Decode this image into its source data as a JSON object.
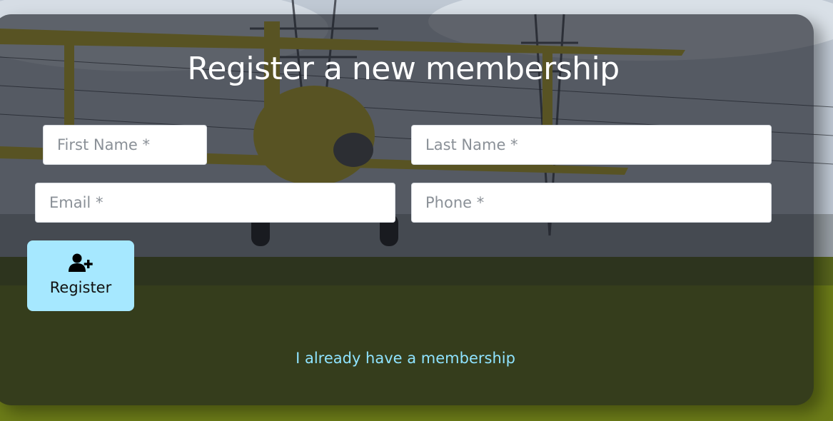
{
  "page": {
    "title": "Register a new membership"
  },
  "form": {
    "first_name": {
      "placeholder": "First Name *",
      "value": ""
    },
    "last_name": {
      "placeholder": "Last Name *",
      "value": ""
    },
    "email": {
      "placeholder": "Email *",
      "value": ""
    },
    "phone": {
      "placeholder": "Phone *",
      "value": ""
    }
  },
  "register_button": {
    "label": "Register",
    "icon": "user-plus-icon"
  },
  "login_link": {
    "label": "I already have a membership"
  },
  "colors": {
    "button_bg": "#a6e8ff",
    "link": "#8fe3ff",
    "card_overlay": "rgba(20,22,30,0.62)"
  },
  "background": {
    "icon": "crop-duster-biplane-over-field"
  }
}
